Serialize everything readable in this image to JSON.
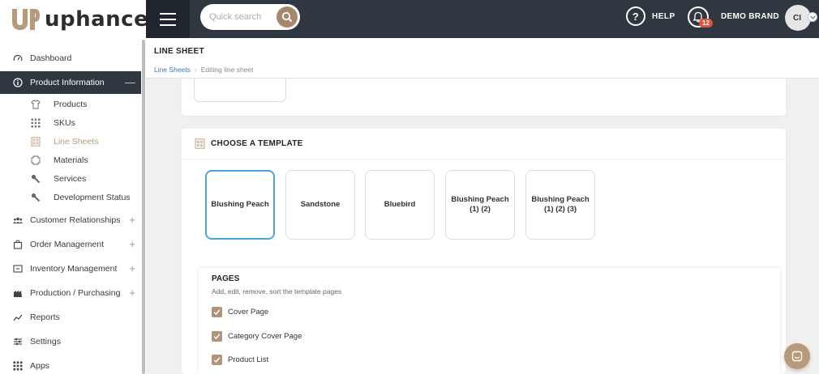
{
  "brand": {
    "logo_text": "uphance",
    "logo_mark": "UP",
    "accent": "#a5876c"
  },
  "topbar": {
    "search_placeholder": "Quick search",
    "help_label": "HELP",
    "help_icon": "?",
    "notifications_count": "12",
    "brand_name": "DEMO BRAND",
    "avatar_initials": "CI"
  },
  "sidebar": {
    "dashboard": "Dashboard",
    "product_information": "Product Information",
    "sub": {
      "products": "Products",
      "skus": "SKUs",
      "line_sheets": "Line Sheets",
      "materials": "Materials",
      "services": "Services",
      "development_status": "Development Status"
    },
    "customer_relationships": "Customer Relationships",
    "order_management": "Order Management",
    "inventory_management": "Inventory Management",
    "production_purchasing": "Production / Purchasing",
    "reports": "Reports",
    "settings": "Settings",
    "apps": "Apps"
  },
  "header": {
    "title": "LINE SHEET",
    "breadcrumb_link": "Line Sheets",
    "breadcrumb_sep": "›",
    "breadcrumb_current": "Editing line sheet"
  },
  "template_card": {
    "title": "CHOOSE A TEMPLATE",
    "templates": [
      "Blushing Peach",
      "Sandstone",
      "Bluebird",
      "Blushing Peach (1) (2)",
      "Blushing Peach (1) (2) (3)"
    ],
    "selected_index": 0
  },
  "pages": {
    "title": "PAGES",
    "subtitle": "Add, edit, remove, sort the template pages",
    "items": [
      {
        "label": "Cover Page",
        "checked": true
      },
      {
        "label": "Category Cover Page",
        "checked": true
      },
      {
        "label": "Product List",
        "checked": true
      }
    ]
  }
}
